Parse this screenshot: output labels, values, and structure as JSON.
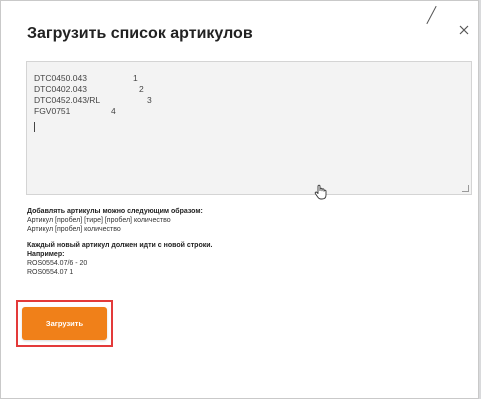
{
  "modal": {
    "title": "Загрузить список артикулов",
    "close_icon": "close-icon"
  },
  "textarea": {
    "lines": [
      {
        "article": "DTC0450.043",
        "qty": "1"
      },
      {
        "article": "DTC0402.043",
        "qty": "2"
      },
      {
        "article": "DTC0452.043/RL",
        "qty": "3"
      },
      {
        "article": "FGV0751",
        "qty": "4"
      }
    ]
  },
  "help": {
    "heading": "Добавлять артикулы можно следующим образом:",
    "format1": "Артикул [пробел] [тире] [пробел] количество",
    "format2": "Артикул [пробел] количество",
    "newline_rule": "Каждый новый артикул должен идти с новой строки.",
    "example_label": "Например:",
    "example1": "ROS0554.07/6 - 20",
    "example2": "ROS0554.07 1"
  },
  "actions": {
    "upload_label": "Загрузить",
    "accent_color": "#f08019",
    "highlight_color": "#e33a3a"
  }
}
